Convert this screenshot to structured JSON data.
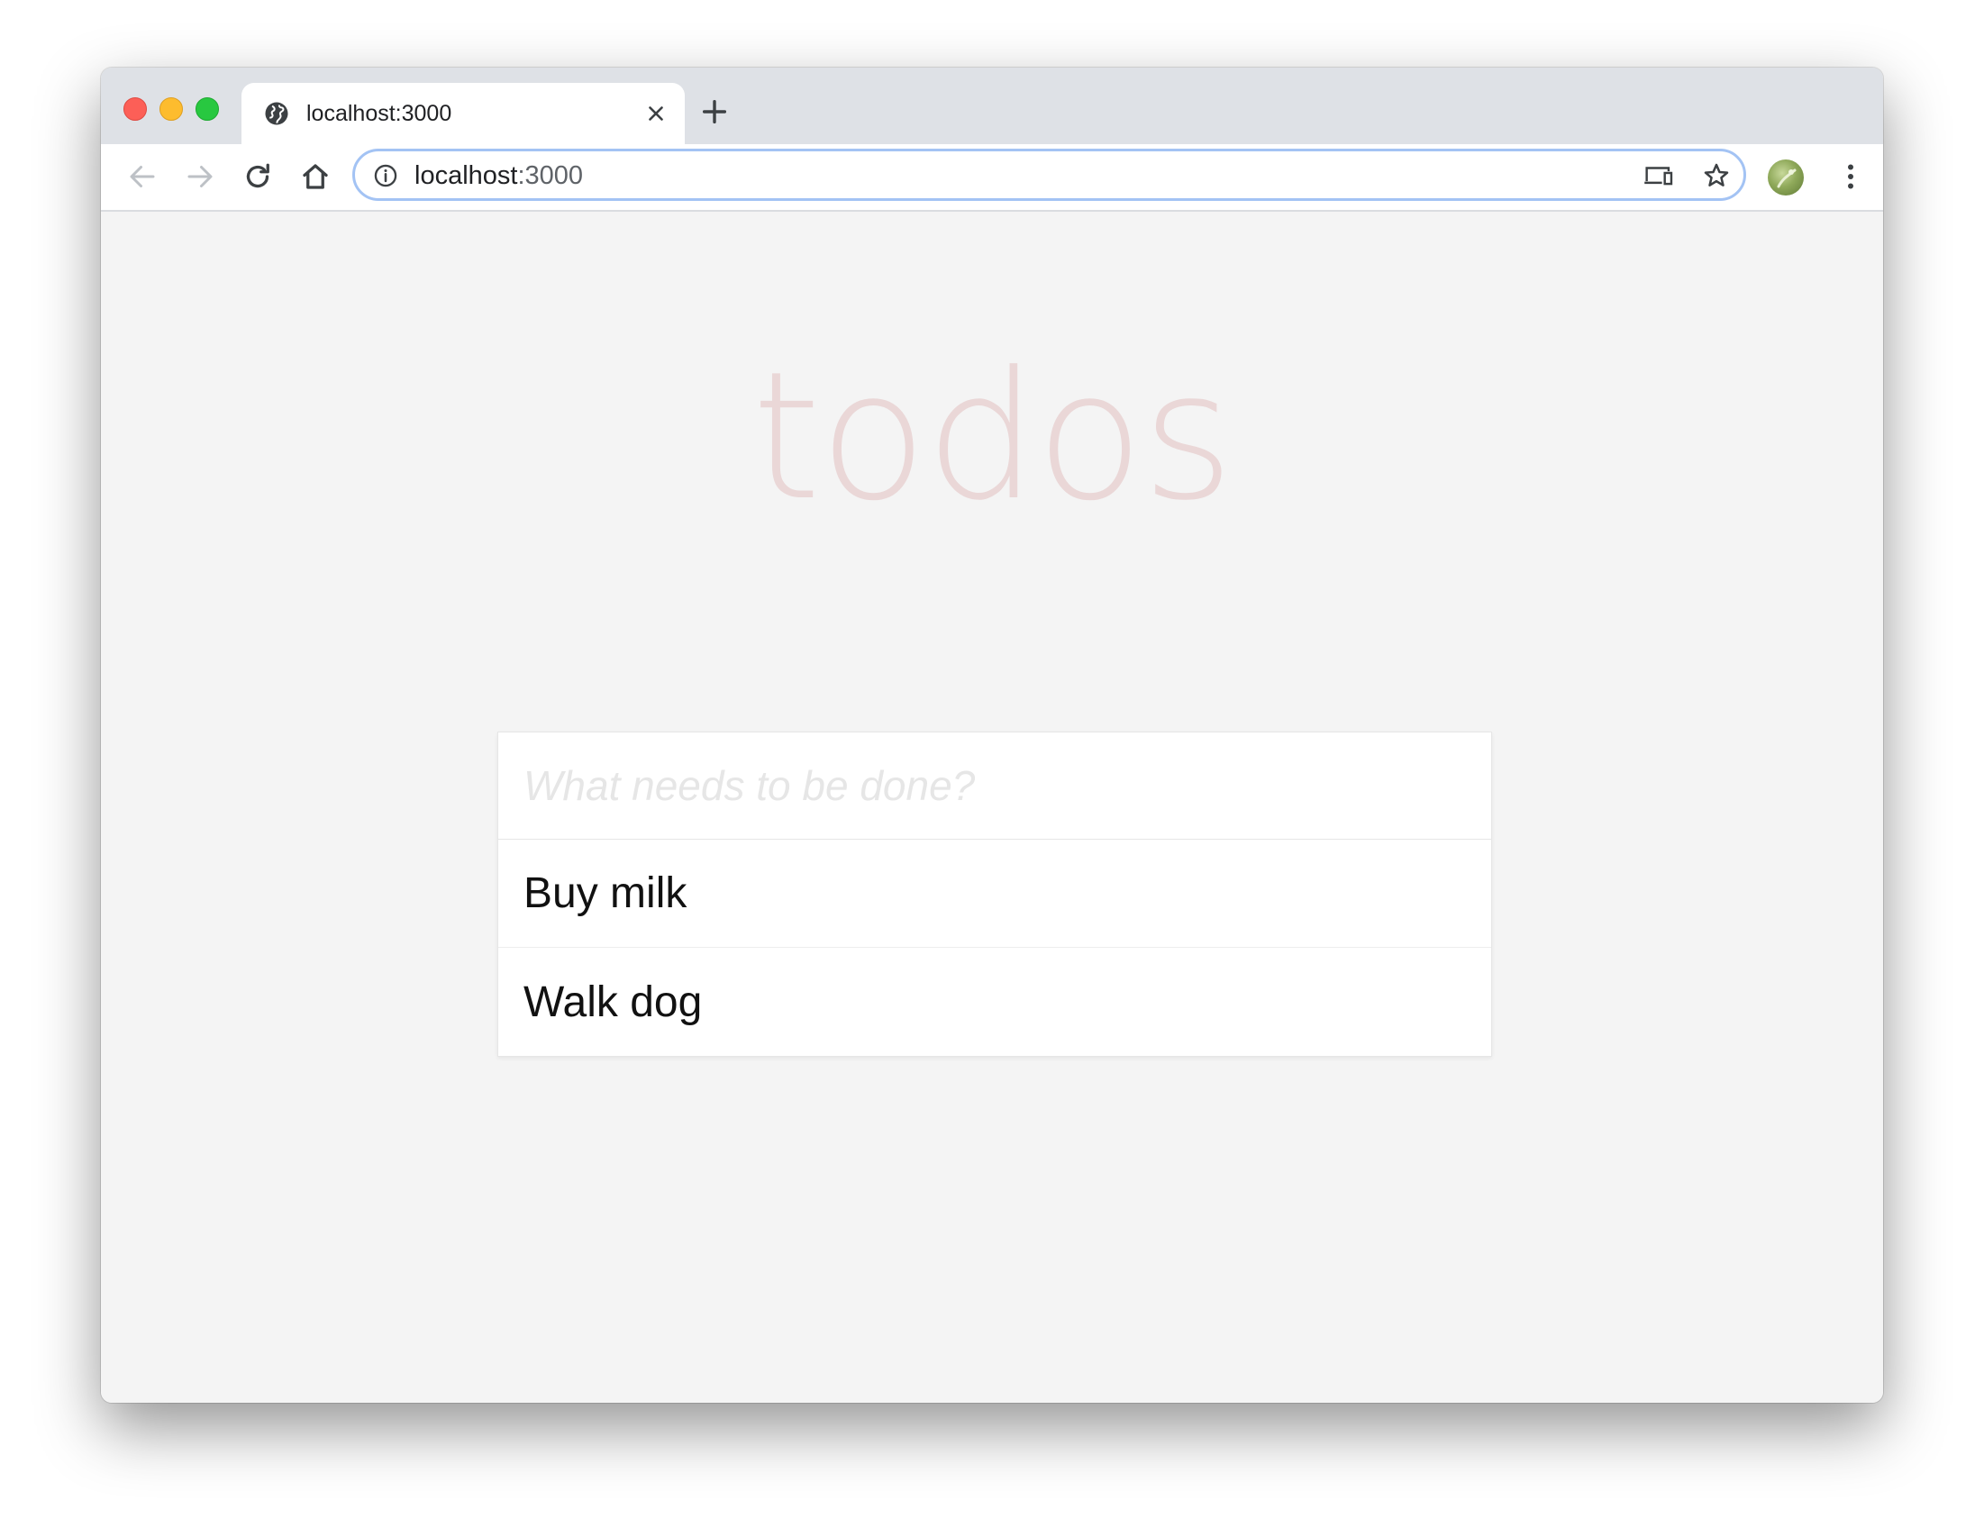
{
  "browser": {
    "tab": {
      "title": "localhost:3000",
      "favicon": "globe-icon"
    },
    "address_bar": {
      "host": "localhost",
      "port": ":3000",
      "info_icon": "info-icon"
    },
    "icons": {
      "back": "arrow-left-icon",
      "forward": "arrow-right-icon",
      "reload": "reload-icon",
      "home": "home-icon",
      "cast": "cast-icon",
      "bookmark": "star-icon",
      "profile": "avatar",
      "menu": "kebab-menu-icon",
      "new_tab": "plus-icon",
      "close_tab": "close-icon"
    },
    "colors": {
      "tabstrip": "#dee1e6",
      "omnibox_focus": "#a3c3f4",
      "traffic_close": "#fc5f57",
      "traffic_minimize": "#fdbc2e",
      "traffic_maximize": "#28c840"
    }
  },
  "app": {
    "title": "todos",
    "new_todo_placeholder": "What needs to be done?",
    "new_todo_value": "",
    "todos": [
      {
        "label": "Buy milk"
      },
      {
        "label": "Walk dog"
      }
    ],
    "colors": {
      "title": "#ead7d7",
      "background": "#f4f4f4",
      "card": "#ffffff"
    }
  }
}
